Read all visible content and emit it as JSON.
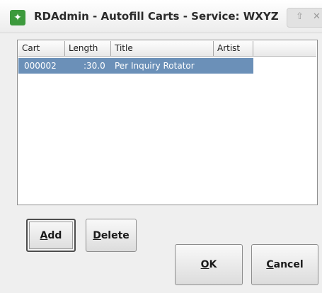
{
  "window": {
    "title": "RDAdmin - Autofill Carts - Service: WXYZ",
    "icon": "rivendell-app-icon",
    "controls": {
      "restore": "⇧",
      "close": "✕"
    }
  },
  "list": {
    "columns": [
      "Cart",
      "Length",
      "Title",
      "Artist"
    ],
    "rows": [
      {
        "cart": "000002",
        "length": ":30.0",
        "title": "Per Inquiry Rotator",
        "artist": "",
        "selected": true
      }
    ]
  },
  "buttons": {
    "add": {
      "mnemonic": "A",
      "rest": "dd"
    },
    "delete": {
      "mnemonic": "D",
      "rest": "elete"
    },
    "ok": {
      "mnemonic": "O",
      "rest": "K"
    },
    "cancel": {
      "mnemonic": "C",
      "rest": "ancel"
    }
  },
  "colors": {
    "selection": "#6b90b8",
    "window_bg": "#efefef",
    "icon_green": "#3d9a3d"
  }
}
